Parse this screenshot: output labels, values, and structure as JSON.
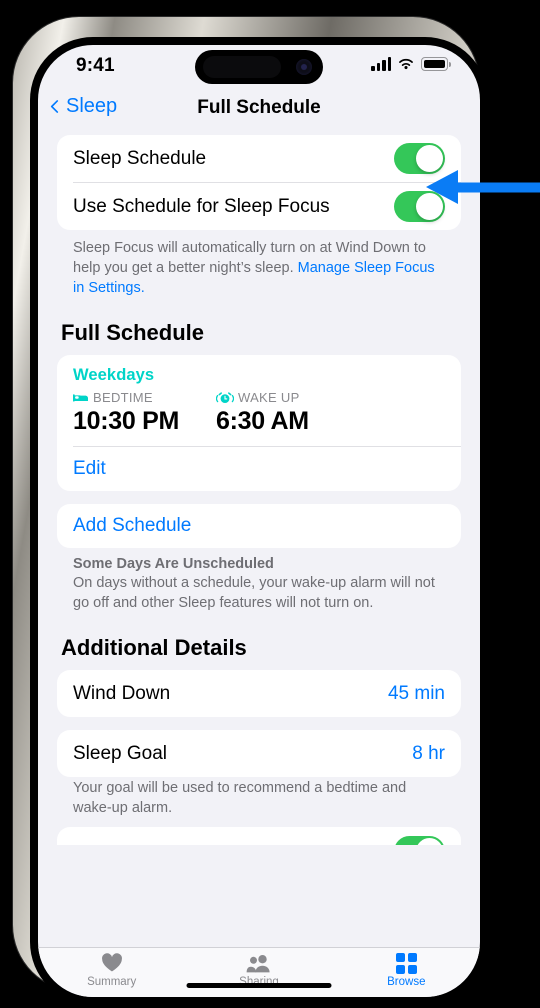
{
  "status_bar": {
    "time": "9:41",
    "signal_icon": "cellular-signal-icon",
    "wifi_icon": "wifi-icon",
    "battery_icon": "battery-full-icon"
  },
  "nav": {
    "back_label": "Sleep",
    "back_icon": "chevron-left-icon",
    "title": "Full Schedule"
  },
  "settings_group": {
    "rows": [
      {
        "label": "Sleep Schedule",
        "toggle": "on"
      },
      {
        "label": "Use Schedule for Sleep Focus",
        "toggle": "on"
      }
    ],
    "footnote_text_1": "Sleep Focus will automatically turn on at Wind Down to help you get a better night’s sleep. ",
    "footnote_link": "Manage Sleep Focus in Settings."
  },
  "full_schedule": {
    "heading": "Full Schedule",
    "schedule": {
      "name": "Weekdays",
      "bedtime_icon": "bed-icon",
      "bedtime_label": "BEDTIME",
      "bedtime_value": "10:30 PM",
      "wakeup_icon": "alarm-clock-icon",
      "wakeup_label": "WAKE UP",
      "wakeup_value": "6:30 AM",
      "edit_label": "Edit"
    },
    "add_schedule_label": "Add Schedule",
    "note_title": "Some Days Are Unscheduled",
    "note_body": "On days without a schedule, your wake-up alarm will not go off and other Sleep features will not turn on."
  },
  "additional_details": {
    "heading": "Additional Details",
    "rows": [
      {
        "label": "Wind Down",
        "value": "45 min"
      },
      {
        "label": "Sleep Goal",
        "value": "8 hr"
      }
    ],
    "footnote": "Your goal will be used to recommend a bedtime and wake-up alarm."
  },
  "tab_bar": {
    "tabs": [
      {
        "label": "Summary",
        "icon": "heart-icon",
        "active": false
      },
      {
        "label": "Sharing",
        "icon": "people-icon",
        "active": false
      },
      {
        "label": "Browse",
        "icon": "grid-squares-icon",
        "active": true
      }
    ]
  },
  "annotation": {
    "arrow_icon": "left-pointing-arrow",
    "arrow_color": "#0A7CF5",
    "points_at": "Sleep Schedule toggle"
  },
  "colors": {
    "accent_blue": "#007AFF",
    "toggle_green": "#34C759",
    "schedule_teal": "#00D4C8",
    "page_background": "#F2F2F7"
  }
}
